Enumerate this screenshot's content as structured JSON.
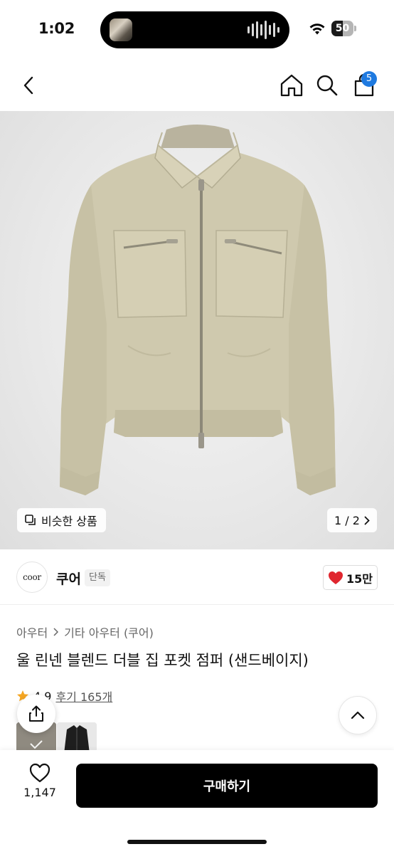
{
  "status": {
    "time": "1:02",
    "battery": "50",
    "battery_level": 0.5
  },
  "nav": {
    "cart_count": "5"
  },
  "gallery": {
    "similar_label": "비슷한 상품",
    "page": "1 / 2"
  },
  "brand": {
    "logo_text": "coor",
    "name": "쿠어",
    "tag": "단독",
    "likes": "15만"
  },
  "product": {
    "breadcrumb": [
      "아우터",
      "기타 아우터 (쿠어)"
    ],
    "title": "울 린넨 블렌드 더블 집 포켓 점퍼 (샌드베이지)",
    "rating": "4.9",
    "reviews": "후기 165개"
  },
  "bottom": {
    "wish_count": "1,147",
    "buy_label": "구매하기"
  },
  "colors": {
    "accent": "#1f7ae0",
    "heart": "#e0262f",
    "buy": "#000000",
    "jacket": "#cfc9ae"
  }
}
